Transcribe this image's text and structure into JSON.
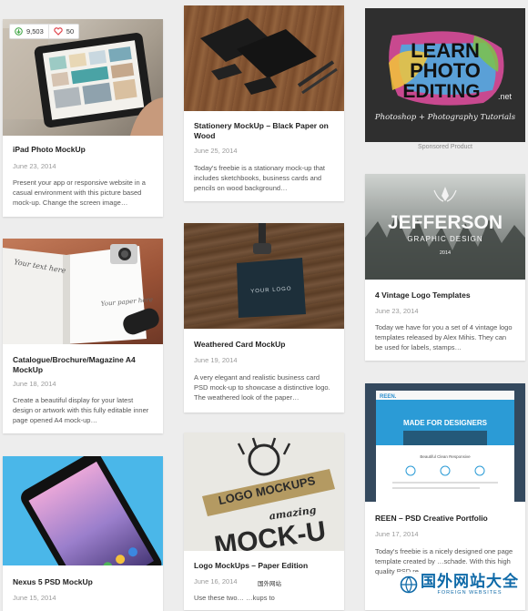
{
  "cards": {
    "ipad": {
      "title": "iPad Photo MockUp",
      "date": "June 23, 2014",
      "desc": "Present your app or responsive website in a casual environment with this picture based mock-up. Change the screen image…",
      "downloads": "9,503",
      "likes": "50"
    },
    "stationery": {
      "title": "Stationery MockUp – Black Paper on Wood",
      "date": "June 25, 2014",
      "desc": "Today's freebie is a stationary mock-up that includes sketchbooks, business cards and pencils on wood background…"
    },
    "catalogue": {
      "title": "Catalogue/Brochure/Magazine A4 MockUp",
      "date": "June 18, 2014",
      "desc": "Create a beautiful display for your latest design or artwork with this fully editable inner page opened A4 mock-up…",
      "book_text": "Your text here",
      "book_text2": "Your paper here"
    },
    "weathered": {
      "title": "Weathered Card MockUp",
      "date": "June 19, 2014",
      "desc": "A very elegant and realistic business card PSD mock-up to showcase a distinctive logo. The weathered look of the paper…",
      "card_text": "YOUR LOGO"
    },
    "nexus": {
      "title": "Nexus 5 PSD MockUp",
      "date": "June 15, 2014"
    },
    "paper_logo": {
      "title": "Logo MockUps – Paper Edition",
      "date": "June 16, 2014",
      "desc": "Use these two…                 …kups to",
      "img_text1": "LOGO MOCKUPS",
      "img_text2": "amazing",
      "img_text3": "MOCK-U"
    },
    "vintage": {
      "title": "4 Vintage Logo Templates",
      "date": "June 23, 2014",
      "desc": "Today we have for you a set of 4 vintage logo templates released by Alex Mihis. They can be used for labels, stamps…",
      "img_title": "JEFFERSON",
      "img_sub": "GRAPHIC DESIGN",
      "img_year": "2014"
    },
    "reen": {
      "title": "REEN – PSD Creative Portfolio",
      "date": "June 17, 2014",
      "desc": "Today's freebie is a nicely designed one page template created by …schade. With this high quality PSD re…",
      "img_brand": "REEN.",
      "img_banner": "MADE FOR DESIGNERS",
      "img_section": "Beautiful Clean Responsive"
    }
  },
  "ad": {
    "line1": "LEARN",
    "line2": "PHOTO",
    "line3": "EDITING",
    "suffix": ".net",
    "tagline": "Photoshop + Photography Tutorials",
    "sponsored": "Sponsored Product"
  },
  "watermark": {
    "title": "国外网站大全",
    "subtitle": "FOREIGN WEBSITES",
    "small": "国外网站"
  }
}
